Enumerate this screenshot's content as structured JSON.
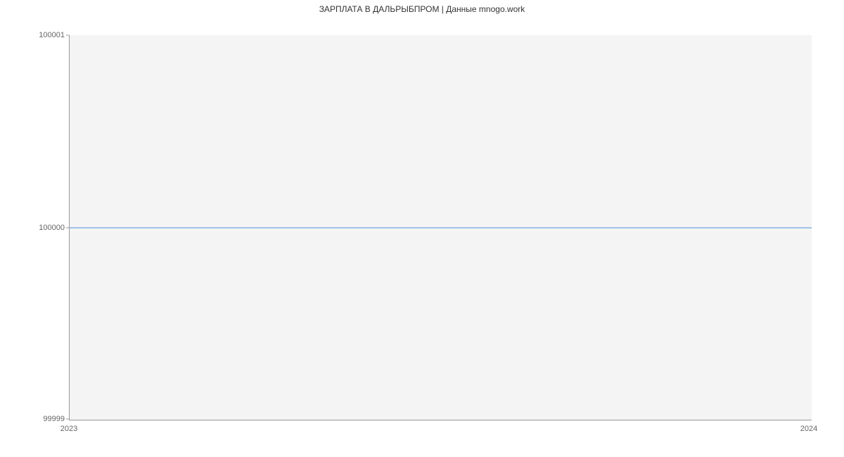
{
  "chart_data": {
    "type": "line",
    "title": "ЗАРПЛАТА В  ДАЛЬРЫБПРОМ | Данные mnogo.work",
    "x": [
      2023,
      2024
    ],
    "values": [
      100000,
      100000
    ],
    "xlabel": "",
    "ylabel": "",
    "xlim": [
      2023,
      2024
    ],
    "ylim": [
      99999,
      100001
    ],
    "x_ticks": [
      "2023",
      "2024"
    ],
    "y_ticks": [
      "99999",
      "100000",
      "100001"
    ],
    "series_color": "#4a90e2"
  }
}
